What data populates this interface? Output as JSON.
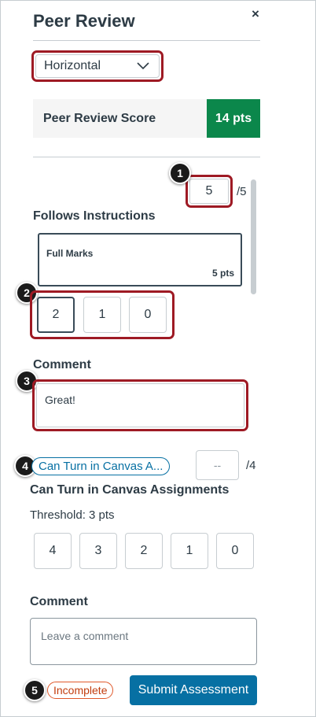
{
  "panel": {
    "title": "Peer Review",
    "close_icon": "close-icon",
    "close_glyph": "×"
  },
  "view_select": {
    "value": "Horizontal",
    "icon": "chevron-down-icon"
  },
  "score_summary": {
    "label": "Peer Review Score",
    "value": "14 pts",
    "badge_color": "#0b874b"
  },
  "criteria": [
    {
      "title": "Follows Instructions",
      "score_value": "5",
      "out_of": "/5",
      "selected_rating": {
        "description": "Full Marks",
        "points": "5 pts"
      },
      "point_options": [
        "2",
        "1",
        "0"
      ],
      "selected_point": "2",
      "comment_label": "Comment",
      "comment_value": "Great!"
    },
    {
      "tag": "Can Turn in Canvas A...",
      "title": "Can Turn in Canvas Assignments",
      "score_placeholder": "--",
      "out_of": "/4",
      "threshold": "Threshold: 3 pts",
      "point_options": [
        "4",
        "3",
        "2",
        "1",
        "0"
      ],
      "comment_label": "Comment",
      "comment_placeholder": "Leave a comment"
    }
  ],
  "footer": {
    "status": "Incomplete",
    "submit_label": "Submit Assessment"
  },
  "callouts": [
    "1",
    "2",
    "3",
    "4",
    "5"
  ],
  "colors": {
    "accent": "#0770a3",
    "highlight": "#9e1a24",
    "success": "#0b874b",
    "warning": "#c23c0d"
  }
}
